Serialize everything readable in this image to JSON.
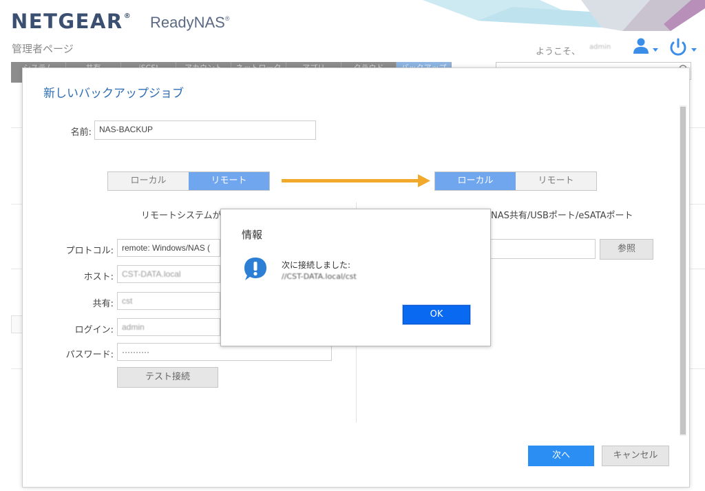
{
  "header": {
    "brand": "NETGEAR",
    "brand_reg": "®",
    "product": "ReadyNAS",
    "product_reg": "®",
    "subtitle": "管理者ページ",
    "welcome": "ようこそ、",
    "user": "admin"
  },
  "nav": {
    "tabs": [
      "システム",
      "共有",
      "iSCSI",
      "アカウント",
      "ネットワーク",
      "アプリ",
      "クラウド",
      "バックアップ"
    ],
    "active_index": 7
  },
  "dialog": {
    "title": "新しいバックアップジョブ",
    "name_label": "名前:",
    "name_value": "NAS-BACKUP",
    "source": {
      "local_label": "ローカル",
      "remote_label": "リモート",
      "selected": "リモート",
      "description": "リモートシステムが",
      "protocol_label": "プロトコル:",
      "protocol_value": "remote: Windows/NAS (",
      "host_label": "ホスト:",
      "host_value": "CST-DATA.local",
      "share_label": "共有:",
      "share_value": "cst",
      "login_label": "ログイン:",
      "login_value": "admin",
      "password_label": "パスワード:",
      "password_value": "··········",
      "test_button": "テスト接続"
    },
    "destination": {
      "local_label": "ローカル",
      "remote_label": "リモート",
      "selected": "ローカル",
      "description": "NAS共有/USBポート/eSATAポート",
      "path_value": "",
      "browse_button": "参照"
    },
    "next_button": "次へ",
    "cancel_button": "キャンセル"
  },
  "popup": {
    "title": "情報",
    "message": "次に接続しました:",
    "path": "//CST-DATA.local/cst",
    "ok_button": "OK"
  },
  "colors": {
    "brand": "#3b4f70",
    "accent_blue": "#2a8ef2",
    "segment_active": "#70a6ee",
    "arrow": "#f0a92a",
    "ok_button": "#0969f0"
  }
}
